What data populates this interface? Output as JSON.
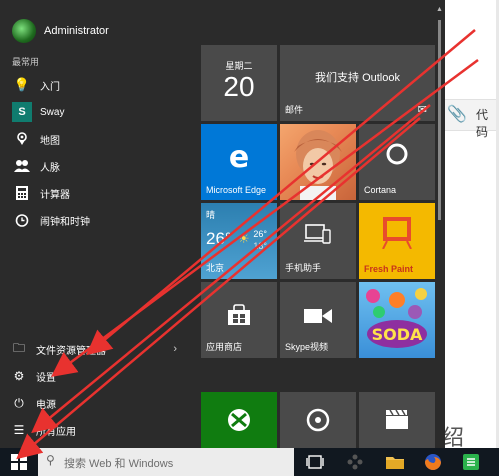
{
  "background_app": {
    "toolbar_text": "代码",
    "bottom_char": "绍"
  },
  "start_menu": {
    "user": {
      "name": "Administrator"
    },
    "section_label": "最常用",
    "apps": [
      {
        "label": "入门",
        "icon": "lightbulb-icon"
      },
      {
        "label": "Sway",
        "icon": "sway-icon"
      },
      {
        "label": "地图",
        "icon": "map-icon"
      },
      {
        "label": "人脉",
        "icon": "people-icon"
      },
      {
        "label": "计算器",
        "icon": "calculator-icon"
      },
      {
        "label": "闹钟和时钟",
        "icon": "alarm-icon"
      }
    ],
    "bottom": {
      "file_explorer": "文件资源管理器",
      "settings": "设置",
      "power": "电源",
      "all_apps": "所有应用"
    },
    "tiles": {
      "calendar": {
        "weekday": "星期二",
        "day": "20"
      },
      "mail": {
        "headline": "我们支持 Outlook",
        "label": "邮件"
      },
      "edge": {
        "label": "Microsoft Edge"
      },
      "photos": {
        "label": ""
      },
      "cortana": {
        "label": "Cortana"
      },
      "weather": {
        "condition": "晴",
        "temp": "26°",
        "high": "26°",
        "low": "18°",
        "city": "北京"
      },
      "phone": {
        "label": "手机助手"
      },
      "freshpaint": {
        "label": "Fresh Paint"
      },
      "store": {
        "label": "应用商店"
      },
      "skype": {
        "label": "Skype视频"
      },
      "candy": {
        "label": "SODA"
      },
      "xbox": {
        "label": ""
      },
      "groove": {
        "label": ""
      },
      "movies": {
        "label": ""
      }
    }
  },
  "taskbar": {
    "search_placeholder": "搜索 Web 和 Windows"
  },
  "colors": {
    "accent_red": "#e8322f",
    "start_bg": "#2b2b2b",
    "tile_dark": "#4a4a4a",
    "edge_blue": "#0078d7",
    "freshpaint_yellow": "#f4b900",
    "xbox_green": "#107c10"
  }
}
